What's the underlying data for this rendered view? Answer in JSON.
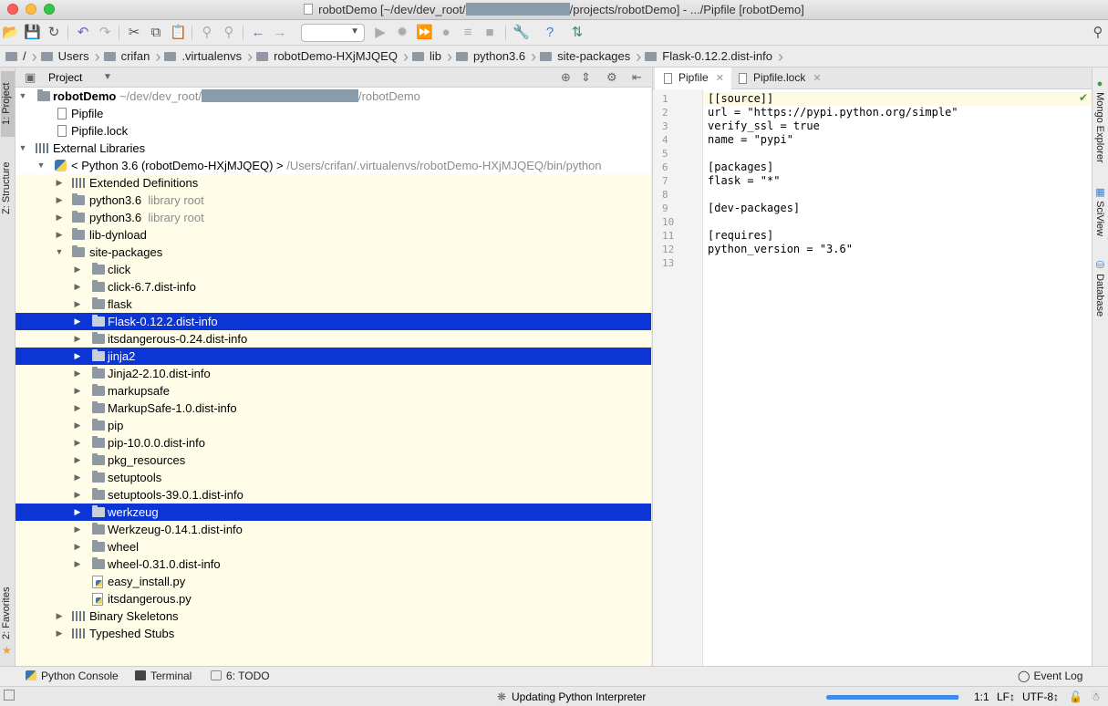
{
  "window": {
    "title_prefix": "robotDemo [~/dev/dev_root/",
    "title_suffix": "/projects/robotDemo] - .../Pipfile [robotDemo]"
  },
  "breadcrumb": [
    "/",
    "Users",
    "crifan",
    ".virtualenvs",
    "robotDemo-HXjMJQEQ",
    "lib",
    "python3.6",
    "site-packages",
    "Flask-0.12.2.dist-info"
  ],
  "toolbar": {
    "icons": [
      "open-folder-icon",
      "save-icon",
      "sync-icon",
      "undo-icon",
      "redo-icon",
      "cut-icon",
      "copy-icon",
      "paste-icon",
      "find-icon",
      "replace-icon",
      "back-icon",
      "forward-icon",
      "run-icon",
      "debug-icon",
      "coverage-icon",
      "profile-icon",
      "concurrency-icon",
      "stop-icon",
      "settings-icon",
      "help-icon",
      "vcs-icon",
      "search-icon"
    ],
    "run_config_value": ""
  },
  "left_stripe": {
    "project_tab": "1: Project",
    "structure_tab": "Z: Structure",
    "favorites_tab": "2: Favorites"
  },
  "right_stripe": {
    "mongo_tab": "Mongo Explorer",
    "sciview_tab": "SciView",
    "database_tab": "Database"
  },
  "project_panel": {
    "header_label": "Project",
    "root": {
      "name": "robotDemo",
      "path_prefix": "~/dev/dev_root/",
      "path_suffix": "/robotDemo"
    },
    "root_files": [
      "Pipfile",
      "Pipfile.lock"
    ],
    "external_libraries": "External Libraries",
    "python_sdk": {
      "name": "< Python 3.6 (robotDemo-HXjMJQEQ) >",
      "path": "/Users/crifan/.virtualenvs/robotDemo-HXjMJQEQ/bin/python"
    },
    "sdk_children": [
      {
        "name": "Extended Definitions",
        "hint": ""
      },
      {
        "name": "python3.6",
        "hint": "library root"
      },
      {
        "name": "python3.6",
        "hint": "library root"
      },
      {
        "name": "lib-dynload",
        "hint": ""
      },
      {
        "name": "site-packages",
        "hint": ""
      }
    ],
    "site_packages": [
      {
        "name": "click",
        "selected": false
      },
      {
        "name": "click-6.7.dist-info",
        "selected": false
      },
      {
        "name": "flask",
        "selected": false
      },
      {
        "name": "Flask-0.12.2.dist-info",
        "selected": true
      },
      {
        "name": "itsdangerous-0.24.dist-info",
        "selected": false
      },
      {
        "name": "jinja2",
        "selected": true
      },
      {
        "name": "Jinja2-2.10.dist-info",
        "selected": false
      },
      {
        "name": "markupsafe",
        "selected": false
      },
      {
        "name": "MarkupSafe-1.0.dist-info",
        "selected": false
      },
      {
        "name": "pip",
        "selected": false
      },
      {
        "name": "pip-10.0.0.dist-info",
        "selected": false
      },
      {
        "name": "pkg_resources",
        "selected": false
      },
      {
        "name": "setuptools",
        "selected": false
      },
      {
        "name": "setuptools-39.0.1.dist-info",
        "selected": false
      },
      {
        "name": "werkzeug",
        "selected": true
      },
      {
        "name": "Werkzeug-0.14.1.dist-info",
        "selected": false
      },
      {
        "name": "wheel",
        "selected": false
      },
      {
        "name": "wheel-0.31.0.dist-info",
        "selected": false
      }
    ],
    "site_files": [
      "easy_install.py",
      "itsdangerous.py"
    ],
    "extra_libs": [
      "Binary Skeletons",
      "Typeshed Stubs"
    ]
  },
  "editor": {
    "tabs": [
      {
        "label": "Pipfile",
        "active": true
      },
      {
        "label": "Pipfile.lock",
        "active": false
      }
    ],
    "lines": [
      "[[source]]",
      "url = \"https://pypi.python.org/simple\"",
      "verify_ssl = true",
      "name = \"pypi\"",
      "",
      "[packages]",
      "flask = \"*\"",
      "",
      "[dev-packages]",
      "",
      "[requires]",
      "python_version = \"3.6\"",
      ""
    ]
  },
  "bottom_tabs": {
    "python_console": "Python Console",
    "terminal": "Terminal",
    "todo": "6: TODO",
    "event_log": "Event Log"
  },
  "status": {
    "message": "Updating Python Interpreter",
    "progress": 0.99,
    "position": "1:1",
    "line_sep": "LF↕",
    "encoding": "UTF-8↕"
  }
}
